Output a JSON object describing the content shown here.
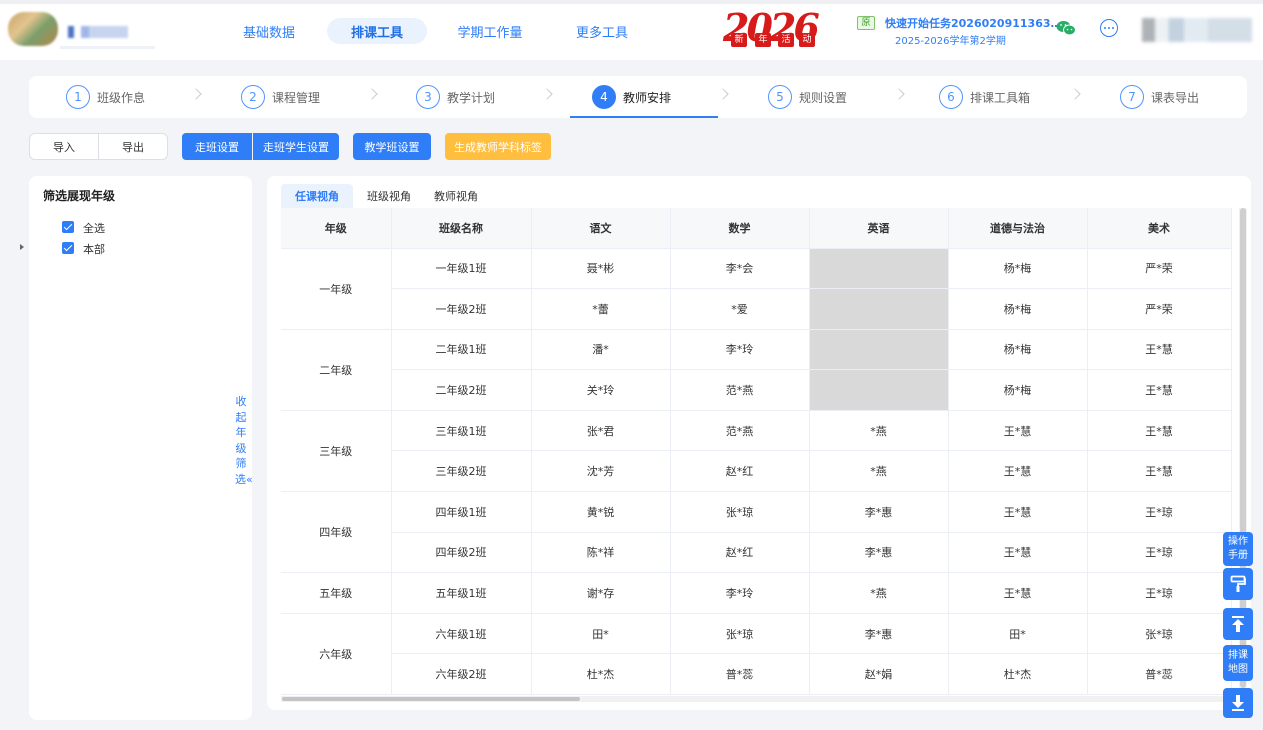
{
  "header": {
    "nav": [
      {
        "label": "基础数据",
        "active": false
      },
      {
        "label": "排课工具",
        "active": true
      },
      {
        "label": "学期工作量",
        "active": false
      },
      {
        "label": "更多工具",
        "active": false
      }
    ],
    "badge": {
      "number": "2026",
      "tags": [
        "新",
        "年",
        "活",
        "动"
      ]
    },
    "task": {
      "flag": "原",
      "title": "快速开始任务2026020911363…",
      "subtitle": "2025-2026学年第2学期"
    }
  },
  "steps": [
    {
      "num": "1",
      "label": "班级作息",
      "active": false
    },
    {
      "num": "2",
      "label": "课程管理",
      "active": false
    },
    {
      "num": "3",
      "label": "教学计划",
      "active": false
    },
    {
      "num": "4",
      "label": "教师安排",
      "active": true
    },
    {
      "num": "5",
      "label": "规则设置",
      "active": false
    },
    {
      "num": "6",
      "label": "排课工具箱",
      "active": false
    },
    {
      "num": "7",
      "label": "课表导出",
      "active": false
    }
  ],
  "toolbar": {
    "import": "导入",
    "export": "导出",
    "walk_class": "走班设置",
    "walk_students": "走班学生设置",
    "teaching_class": "教学班设置",
    "gen_tags": "生成教师学科标签"
  },
  "filter": {
    "title": "筛选展现年级",
    "select_all": "全选",
    "campus": "本部",
    "collapse": "收起年级筛选«"
  },
  "tabs": [
    "任课视角",
    "班级视角",
    "教师视角"
  ],
  "table": {
    "headers": [
      "年级",
      "班级名称",
      "语文",
      "数学",
      "英语",
      "道德与法治",
      "美术"
    ],
    "grades": [
      {
        "grade": "一年级",
        "rows": [
          {
            "class": "一年级1班",
            "cells": [
              "聂*彬",
              "李*会",
              "",
              "杨*梅",
              "严*荣"
            ]
          },
          {
            "class": "一年级2班",
            "cells": [
              "*蕾",
              "*爱",
              "",
              "杨*梅",
              "严*荣"
            ]
          }
        ]
      },
      {
        "grade": "二年级",
        "rows": [
          {
            "class": "二年级1班",
            "cells": [
              "潘*",
              "李*玲",
              "",
              "杨*梅",
              "王*慧"
            ]
          },
          {
            "class": "二年级2班",
            "cells": [
              "关*玲",
              "范*燕",
              "",
              "杨*梅",
              "王*慧"
            ]
          }
        ]
      },
      {
        "grade": "三年级",
        "rows": [
          {
            "class": "三年级1班",
            "cells": [
              "张*君",
              "范*燕",
              "*燕",
              "王*慧",
              "王*慧"
            ]
          },
          {
            "class": "三年级2班",
            "cells": [
              "沈*芳",
              "赵*红",
              "*燕",
              "王*慧",
              "王*慧"
            ]
          }
        ]
      },
      {
        "grade": "四年级",
        "rows": [
          {
            "class": "四年级1班",
            "cells": [
              "黄*锐",
              "张*琼",
              "李*惠",
              "王*慧",
              "王*琼"
            ]
          },
          {
            "class": "四年级2班",
            "cells": [
              "陈*祥",
              "赵*红",
              "李*惠",
              "王*慧",
              "王*琼"
            ]
          }
        ]
      },
      {
        "grade": "五年级",
        "rows": [
          {
            "class": "五年级1班",
            "cells": [
              "谢*存",
              "李*玲",
              "*燕",
              "王*慧",
              "王*琼"
            ]
          }
        ]
      },
      {
        "grade": "六年级",
        "rows": [
          {
            "class": "六年级1班",
            "cells": [
              "田*",
              "张*琼",
              "李*惠",
              "田*",
              "张*琼"
            ]
          },
          {
            "class": "六年级2班",
            "cells": [
              "杜*杰",
              "普*蕊",
              "赵*娟",
              "杜*杰",
              "普*蕊"
            ]
          }
        ]
      }
    ]
  },
  "side_buttons": {
    "manual": "操作手册",
    "map": "排课地图"
  },
  "colors": {
    "primary": "#2f7ef7",
    "orange": "#ffbe3d",
    "gray_cell": "#d9d9d9",
    "badge_red": "#d71a1a"
  }
}
